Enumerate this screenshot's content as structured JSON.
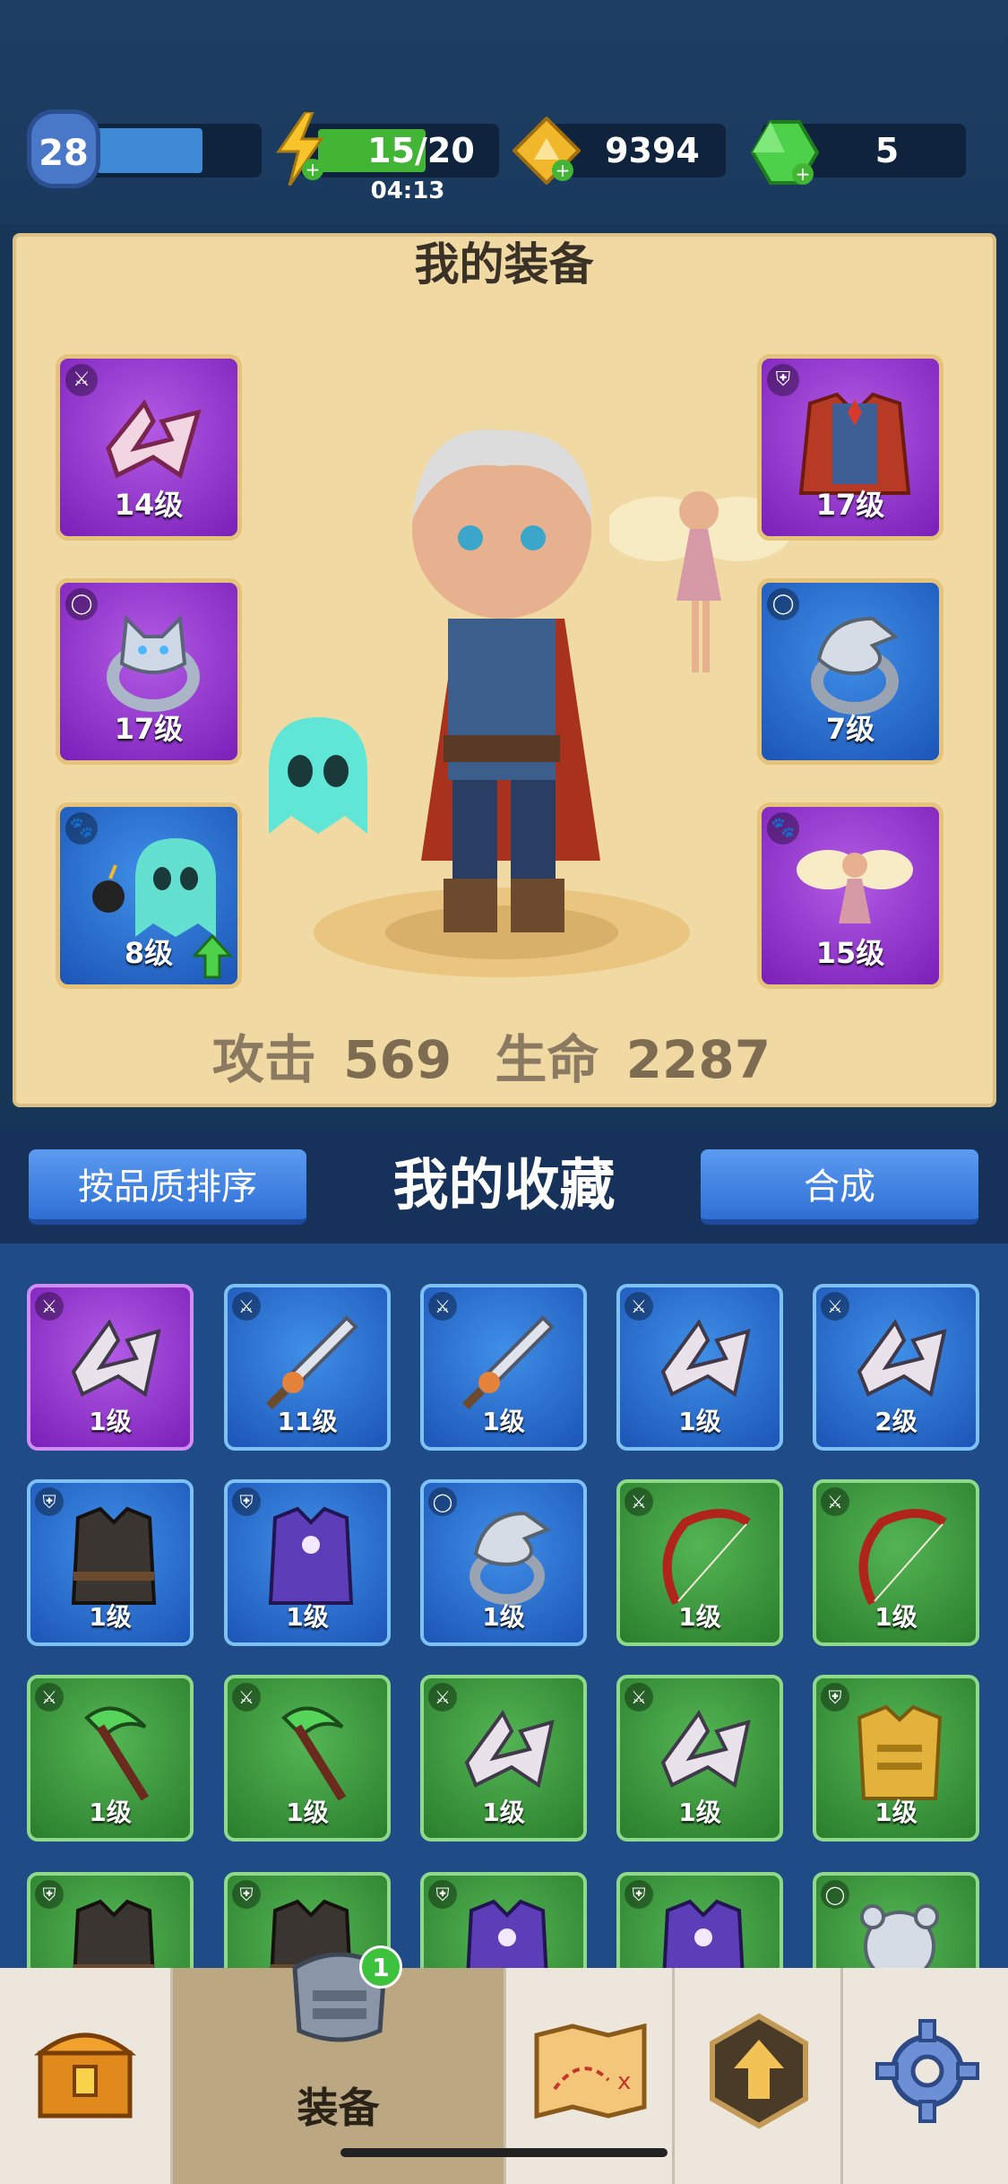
{
  "topbar": {
    "level": "28",
    "energy": "15/20",
    "energy_timer": "04:13",
    "gold": "9394",
    "gems": "5"
  },
  "equipment": {
    "title": "我的装备",
    "slots": [
      {
        "icon": "shuriken-icon",
        "level": "14级",
        "rarity": "purple"
      },
      {
        "icon": "wolf-ring-icon",
        "level": "17级",
        "rarity": "purple"
      },
      {
        "icon": "ghost-pet-icon",
        "level": "8级",
        "rarity": "blue"
      },
      {
        "icon": "robe-armor-icon",
        "level": "17级",
        "rarity": "purple"
      },
      {
        "icon": "eagle-ring-icon",
        "level": "7级",
        "rarity": "blue"
      },
      {
        "icon": "fairy-pet-icon",
        "level": "15级",
        "rarity": "purple"
      }
    ],
    "stats": {
      "attack_label": "攻击",
      "attack_value": "569",
      "hp_label": "生命",
      "hp_value": "2287"
    }
  },
  "collection": {
    "sort_button": "按品质排序",
    "title": "我的收藏",
    "merge_button": "合成",
    "items": [
      {
        "icon": "shuriken-icon",
        "level": "1级",
        "rarity": "purple"
      },
      {
        "icon": "sword-icon",
        "level": "11级",
        "rarity": "blue"
      },
      {
        "icon": "sword-icon",
        "level": "1级",
        "rarity": "blue"
      },
      {
        "icon": "shuriken-icon",
        "level": "1级",
        "rarity": "blue"
      },
      {
        "icon": "shuriken-icon",
        "level": "2级",
        "rarity": "blue"
      },
      {
        "icon": "vest-armor-icon",
        "level": "1级",
        "rarity": "blue"
      },
      {
        "icon": "robe-armor-icon",
        "level": "1级",
        "rarity": "blue"
      },
      {
        "icon": "eagle-ring-icon",
        "level": "1级",
        "rarity": "blue"
      },
      {
        "icon": "bow-icon",
        "level": "1级",
        "rarity": "green"
      },
      {
        "icon": "bow-icon",
        "level": "1级",
        "rarity": "green"
      },
      {
        "icon": "scythe-icon",
        "level": "1级",
        "rarity": "green"
      },
      {
        "icon": "scythe-icon",
        "level": "1级",
        "rarity": "green"
      },
      {
        "icon": "shuriken-icon",
        "level": "1级",
        "rarity": "green"
      },
      {
        "icon": "shuriken-icon",
        "level": "1级",
        "rarity": "green"
      },
      {
        "icon": "gold-armor-icon",
        "level": "1级",
        "rarity": "green"
      },
      {
        "icon": "vest-armor-icon",
        "level": "",
        "rarity": "green"
      },
      {
        "icon": "vest-armor-icon",
        "level": "",
        "rarity": "green"
      },
      {
        "icon": "robe-armor-icon",
        "level": "",
        "rarity": "green"
      },
      {
        "icon": "robe-armor-icon",
        "level": "",
        "rarity": "green"
      },
      {
        "icon": "bear-ring-icon",
        "level": "",
        "rarity": "green"
      }
    ]
  },
  "navbar": {
    "items": [
      {
        "icon": "chest-icon",
        "label": ""
      },
      {
        "icon": "armor-icon",
        "label": "装备",
        "badge": "1"
      },
      {
        "icon": "map-icon",
        "label": ""
      },
      {
        "icon": "upgrade-icon",
        "label": ""
      },
      {
        "icon": "gear-icon",
        "label": ""
      }
    ]
  }
}
